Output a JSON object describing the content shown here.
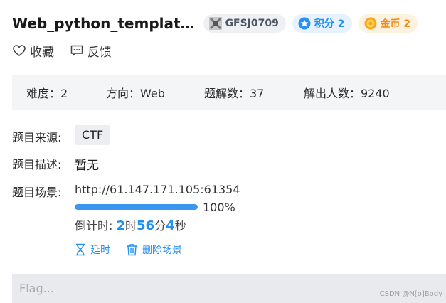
{
  "header": {
    "title": "Web_python_templat…",
    "author": "GFSJ0709",
    "score_label": "积分 2",
    "coin_label": "金币 2"
  },
  "actions": {
    "favorite_label": "收藏",
    "feedback_label": "反馈"
  },
  "stats": {
    "difficulty": "难度：2",
    "direction": "方向：Web",
    "solves": "题解数：37",
    "solvers": "解出人数：9240"
  },
  "info": {
    "source_label": "题目来源:",
    "source_value": "CTF",
    "desc_label": "题目描述:",
    "desc_value": "暂无",
    "scene_label": "题目场景:",
    "scene_url": "http://61.147.171.105:61354",
    "progress_percent": 100,
    "progress_text": "100%",
    "countdown_prefix": "倒计时: ",
    "countdown_h": "2",
    "countdown_h_unit": "时",
    "countdown_m": "56",
    "countdown_m_unit": "分",
    "countdown_s": "4",
    "countdown_s_unit": "秒",
    "extend_label": "延时",
    "delete_label": "删除场景"
  },
  "flag": {
    "placeholder": "Flag..."
  },
  "watermark": "CSDN @N[o]Body",
  "colors": {
    "accent": "#1f8ff0",
    "coin": "#f08c14",
    "stats_bg": "#f4f5f7"
  }
}
